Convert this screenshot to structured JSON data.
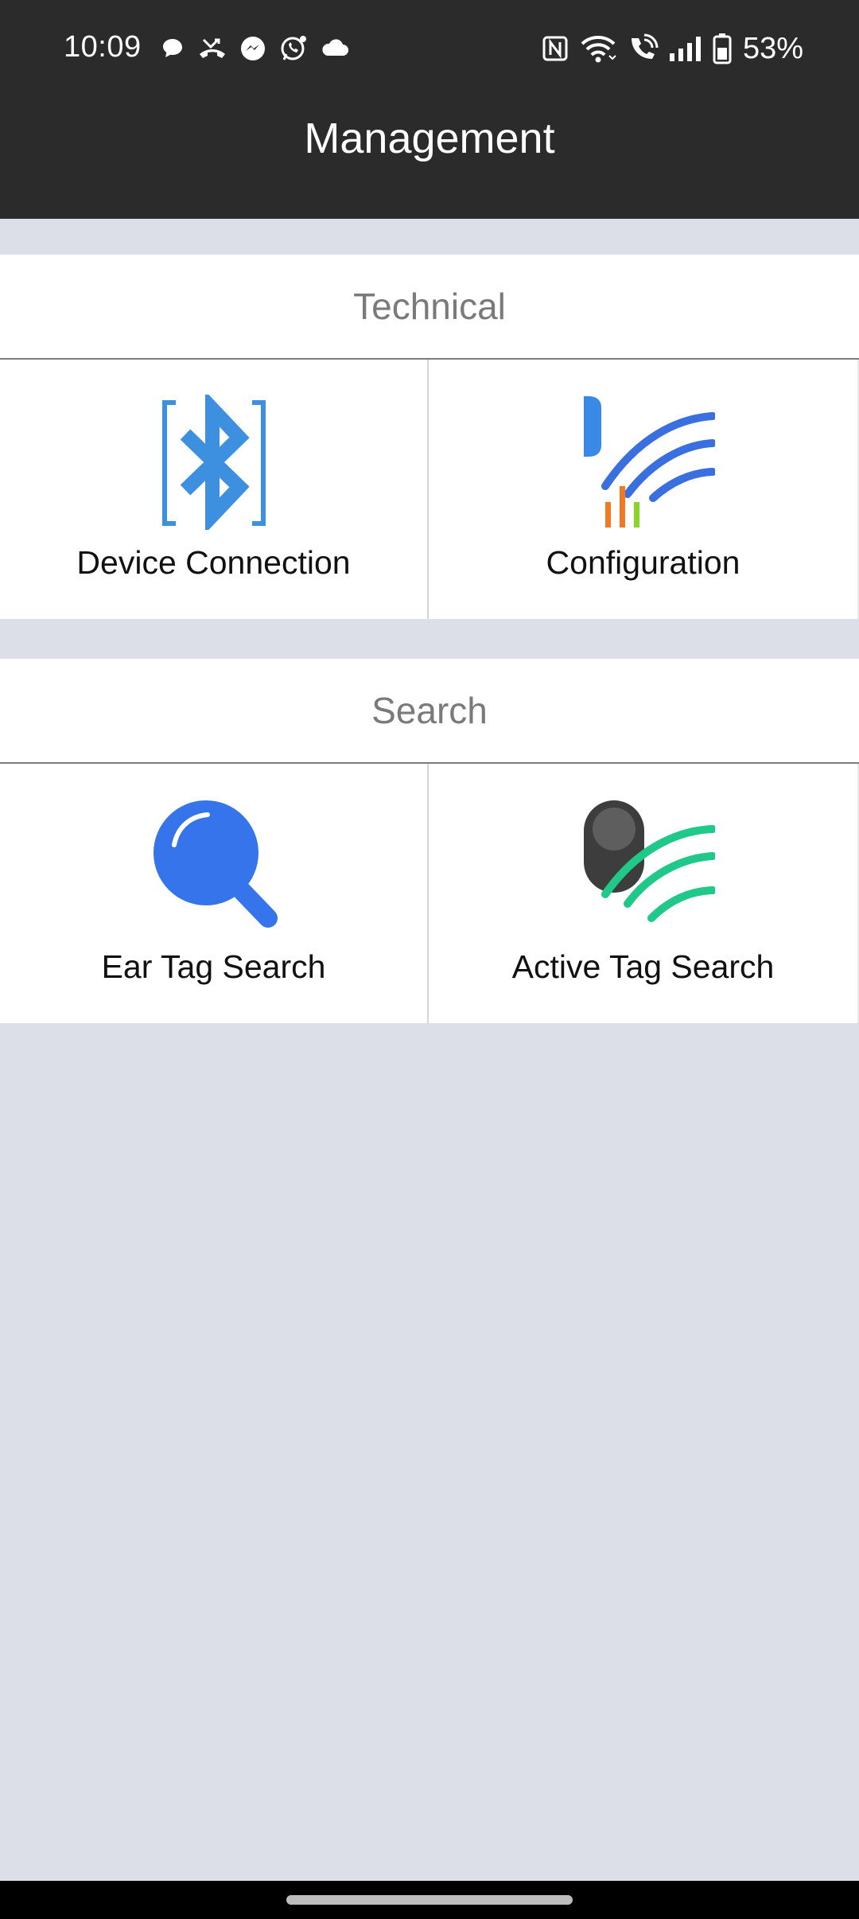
{
  "status_bar": {
    "time": "10:09",
    "battery": "53%",
    "left_icons": [
      "chat-bubble-icon",
      "missed-call-icon",
      "messenger-icon",
      "whatsapp-icon",
      "cloud-icon"
    ],
    "right_icons": [
      "nfc-icon",
      "wifi-icon",
      "wifi-calling-icon",
      "signal-icon",
      "battery-icon"
    ]
  },
  "app_bar": {
    "title": "Management"
  },
  "sections": [
    {
      "title": "Technical",
      "tiles": [
        {
          "label": "Device Connection",
          "icon": "bluetooth-icon"
        },
        {
          "label": "Configuration",
          "icon": "configuration-signal-icon"
        }
      ]
    },
    {
      "title": "Search",
      "tiles": [
        {
          "label": "Ear Tag Search",
          "icon": "magnifier-icon"
        },
        {
          "label": "Active Tag Search",
          "icon": "active-tag-icon"
        }
      ]
    }
  ],
  "colors": {
    "bar_background": "#2b2b2b",
    "page_background": "#dcdfe7",
    "bluetooth_blue": "#3d8fe0",
    "search_blue": "#3574ea",
    "signal_blue": "#3a6fe0",
    "signal_green": "#20c88a",
    "bar_orange": "#f07a24",
    "bar_green": "#8dd42a",
    "tag_dark": "#3d3d3d"
  }
}
